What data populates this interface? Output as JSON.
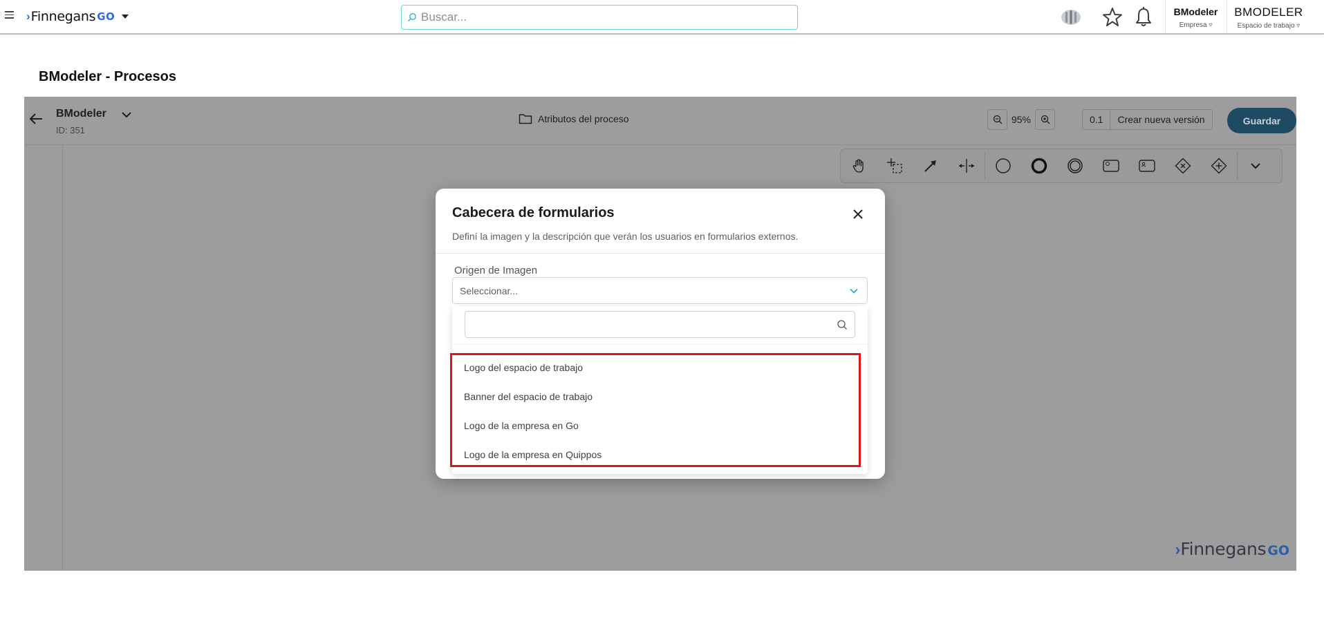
{
  "topbar": {
    "brand_name": "Finnegans",
    "brand_suffix": "GO",
    "search_placeholder": "Buscar...",
    "company_name": "BModeler",
    "company_label": "Empresa",
    "workspace_name": "BMODELER",
    "workspace_label": "Espacio de trabajo"
  },
  "page": {
    "title": "BModeler - Procesos"
  },
  "editor": {
    "process_name": "BModeler",
    "process_id": "ID: 351",
    "attributes_label": "Atributos del proceso",
    "zoom": "95%",
    "version_number": "0.1",
    "new_version_label": "Crear nueva versión",
    "save_label": "Guardar",
    "palette_tools": [
      "hand-tool-icon",
      "lasso-tool-icon",
      "connect-arrow-icon",
      "space-tool-icon",
      "start-event-icon",
      "end-event-icon",
      "intermediate-event-icon",
      "task-icon",
      "user-task-icon",
      "exclusive-gateway-icon",
      "parallel-gateway-icon",
      "expand-icon"
    ],
    "watermark_name": "Finnegans",
    "watermark_suffix": "GO"
  },
  "modal": {
    "title": "Cabecera de formularios",
    "subtitle": "Definí la imagen y la descripción que verán los usuarios en formularios externos.",
    "field_label": "Origen de Imagen",
    "select_value": "Seleccionar...",
    "search_value": "",
    "options": [
      "Logo del espacio de trabajo",
      "Banner del espacio de trabajo",
      "Logo de la empresa en Go",
      "Logo de la empresa en Quippos"
    ]
  },
  "colors": {
    "brand_blue": "#2d6cdf",
    "save_button": "#1e4a63",
    "search_border": "#6fd3e0",
    "highlight": "#e0161b",
    "overlay": "#9d9d9d"
  }
}
